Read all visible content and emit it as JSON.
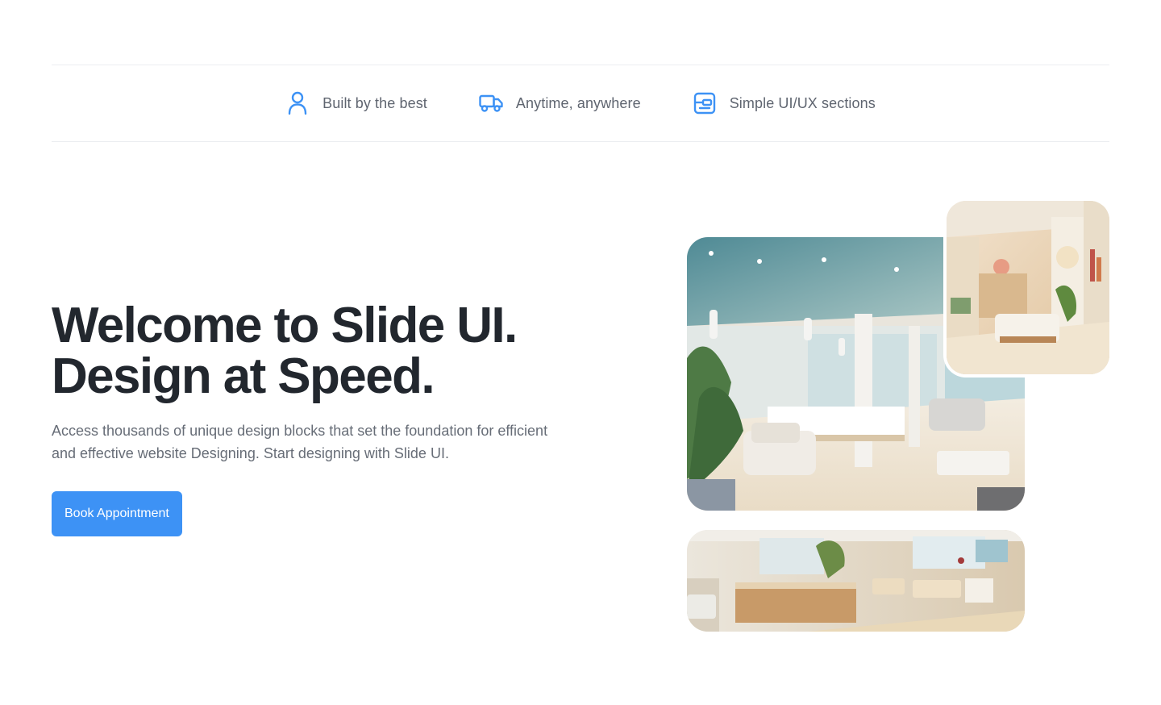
{
  "features": [
    {
      "icon": "user-icon",
      "label": "Built by the best"
    },
    {
      "icon": "truck-icon",
      "label": "Anytime, anywhere"
    },
    {
      "icon": "layout-icon",
      "label": "Simple UI/UX sections"
    }
  ],
  "hero": {
    "title_line1": "Welcome to Slide UI.",
    "title_line2": "Design at Speed.",
    "subtitle": "Access thousands of unique design blocks that set the foundation for efficient and effective website Designing. Start designing with Slide UI.",
    "cta_label": "Book Appointment"
  },
  "colors": {
    "accent": "#3d92f5",
    "heading": "#22272e",
    "body_text": "#676d77"
  }
}
